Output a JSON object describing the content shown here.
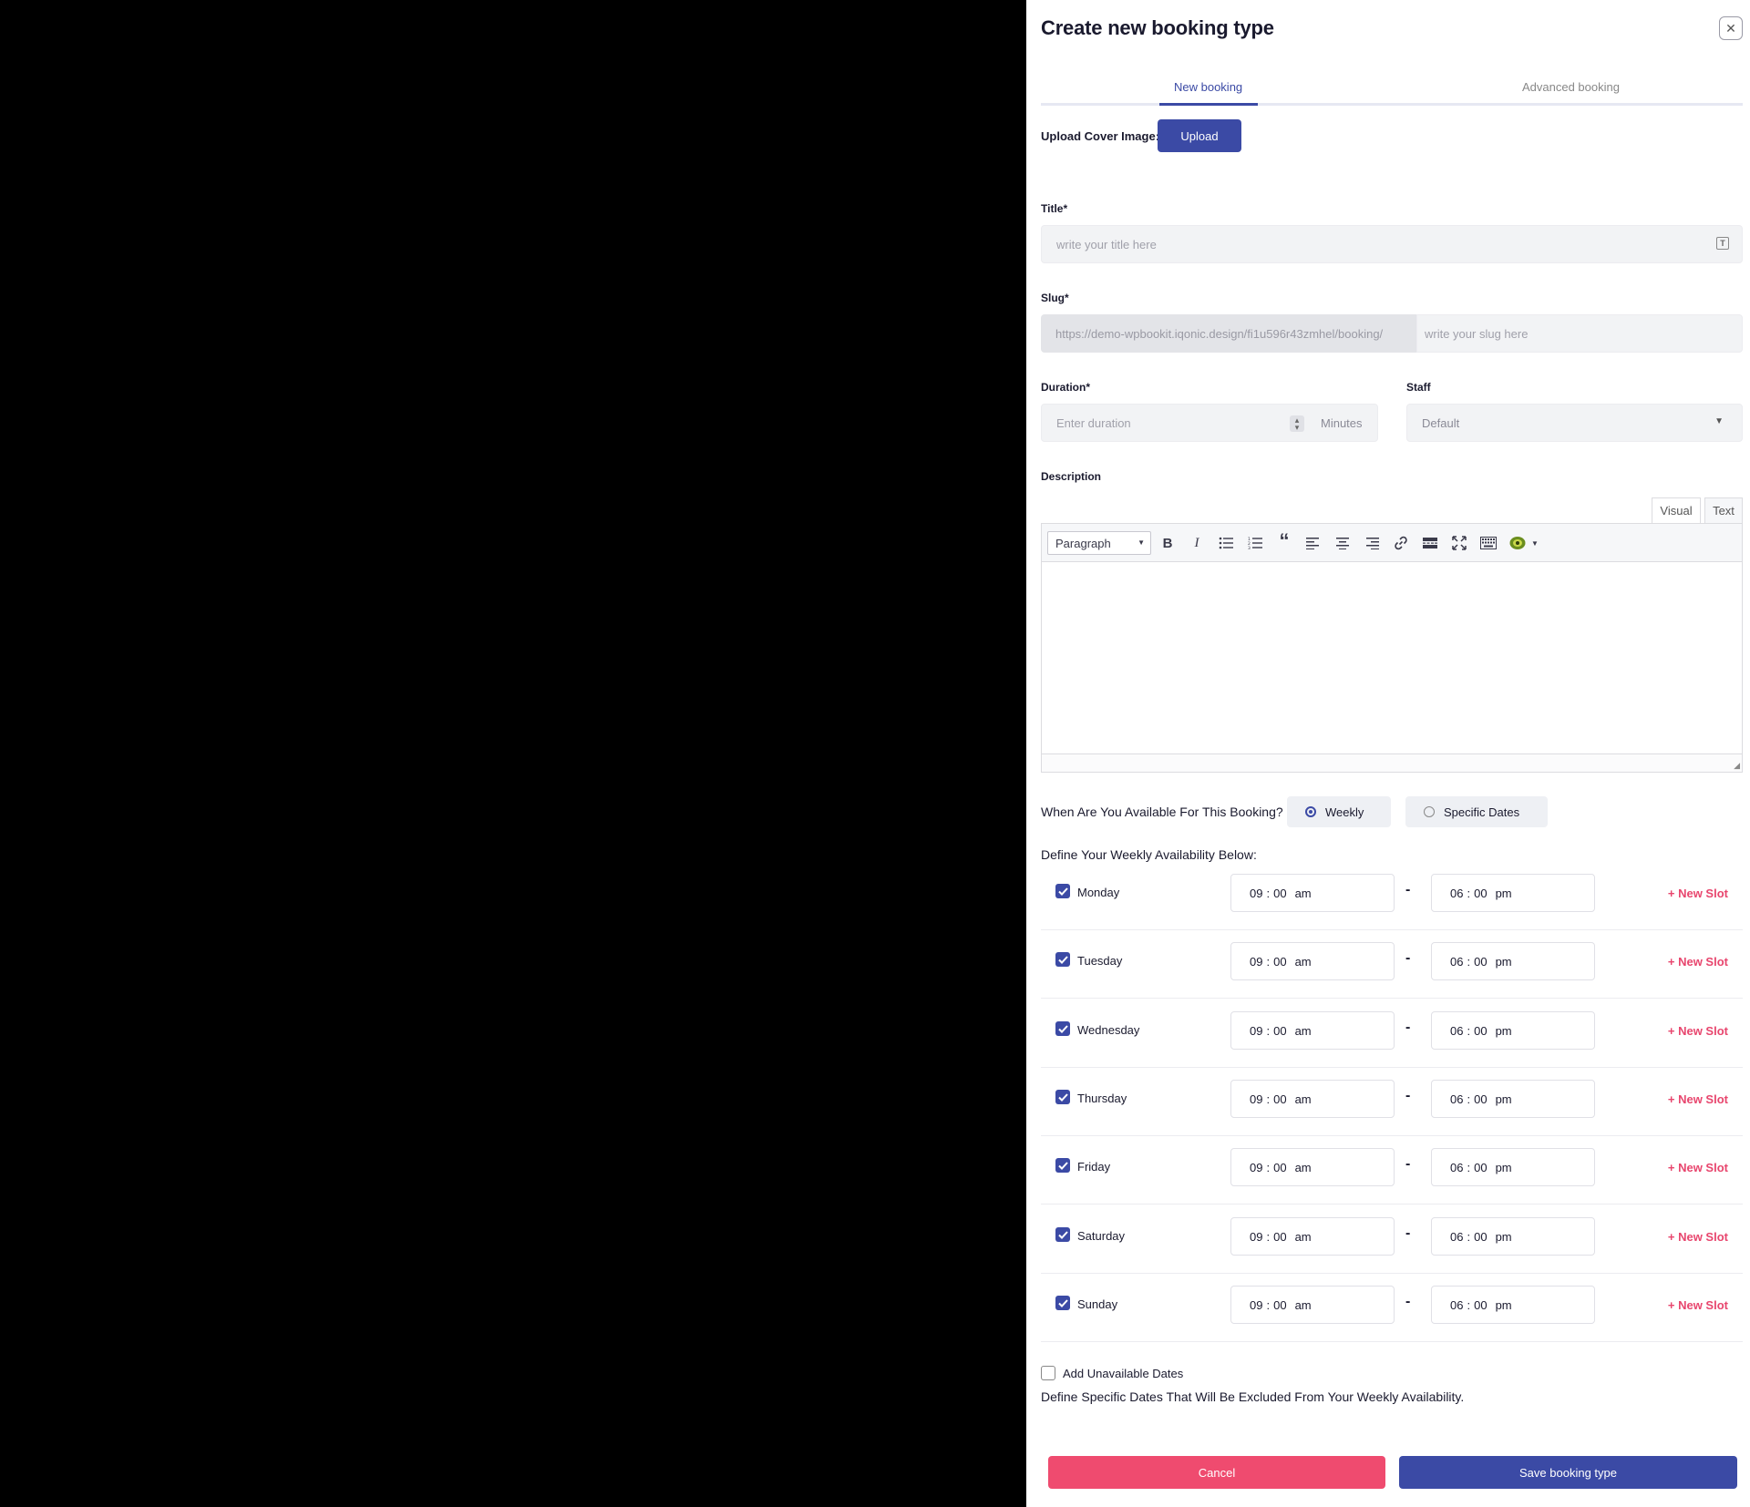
{
  "panel": {
    "title": "Create new booking type",
    "close_glyph": "✕"
  },
  "tabs": [
    {
      "label": "New booking",
      "active": true
    },
    {
      "label": "Advanced booking",
      "active": false
    }
  ],
  "upload": {
    "label": "Upload Cover Image:",
    "button": "Upload"
  },
  "title_field": {
    "label": "Title*",
    "placeholder": "write your title here"
  },
  "slug_field": {
    "label": "Slug*",
    "prefix": "https://demo-wpbookit.iqonic.design/fi1u596r43zmhel/booking/",
    "placeholder": "write your slug here"
  },
  "duration_field": {
    "label": "Duration*",
    "placeholder": "Enter duration",
    "unit": "Minutes"
  },
  "staff_field": {
    "label": "Staff",
    "value": "Default"
  },
  "description": {
    "label": "Description",
    "tab_visual": "Visual",
    "tab_text": "Text",
    "format_select": "Paragraph",
    "toolbar_icons": [
      "bold-icon",
      "italic-icon",
      "bullet-list-icon",
      "numbered-list-icon",
      "blockquote-icon",
      "align-left-icon",
      "align-center-icon",
      "align-right-icon",
      "link-icon",
      "read-more-icon",
      "fullscreen-icon",
      "keyboard-icon",
      "emoji-icon"
    ]
  },
  "availability": {
    "question": "When Are You Available For This Booking?",
    "options": [
      {
        "label": "Weekly",
        "selected": true
      },
      {
        "label": "Specific Dates",
        "selected": false
      }
    ],
    "weekly_heading": "Define Your Weekly Availability Below:",
    "days": [
      {
        "name": "Monday",
        "checked": true,
        "start_h": "09",
        "start_m": "00",
        "start_ap": "am",
        "end_h": "06",
        "end_m": "00",
        "end_ap": "pm",
        "action": "+ New Slot"
      },
      {
        "name": "Tuesday",
        "checked": true,
        "start_h": "09",
        "start_m": "00",
        "start_ap": "am",
        "end_h": "06",
        "end_m": "00",
        "end_ap": "pm",
        "action": "+ New Slot"
      },
      {
        "name": "Wednesday",
        "checked": true,
        "start_h": "09",
        "start_m": "00",
        "start_ap": "am",
        "end_h": "06",
        "end_m": "00",
        "end_ap": "pm",
        "action": "+ New Slot"
      },
      {
        "name": "Thursday",
        "checked": true,
        "start_h": "09",
        "start_m": "00",
        "start_ap": "am",
        "end_h": "06",
        "end_m": "00",
        "end_ap": "pm",
        "action": "+ New Slot"
      },
      {
        "name": "Friday",
        "checked": true,
        "start_h": "09",
        "start_m": "00",
        "start_ap": "am",
        "end_h": "06",
        "end_m": "00",
        "end_ap": "pm",
        "action": "+ New Slot"
      },
      {
        "name": "Saturday",
        "checked": true,
        "start_h": "09",
        "start_m": "00",
        "start_ap": "am",
        "end_h": "06",
        "end_m": "00",
        "end_ap": "pm",
        "action": "+ New Slot"
      },
      {
        "name": "Sunday",
        "checked": true,
        "start_h": "09",
        "start_m": "00",
        "start_ap": "am",
        "end_h": "06",
        "end_m": "00",
        "end_ap": "pm",
        "action": "+ New Slot"
      }
    ],
    "time_separator": "-"
  },
  "unavailable": {
    "checkbox_label": "Add Unavailable Dates",
    "checked": false,
    "help": "Define Specific Dates That Will Be Excluded From Your Weekly Availability."
  },
  "footer": {
    "cancel": "Cancel",
    "save": "Save booking type"
  },
  "colors": {
    "primary": "#3b4aa5",
    "danger": "#ef4b6f",
    "new_slot": "#e8466e"
  }
}
